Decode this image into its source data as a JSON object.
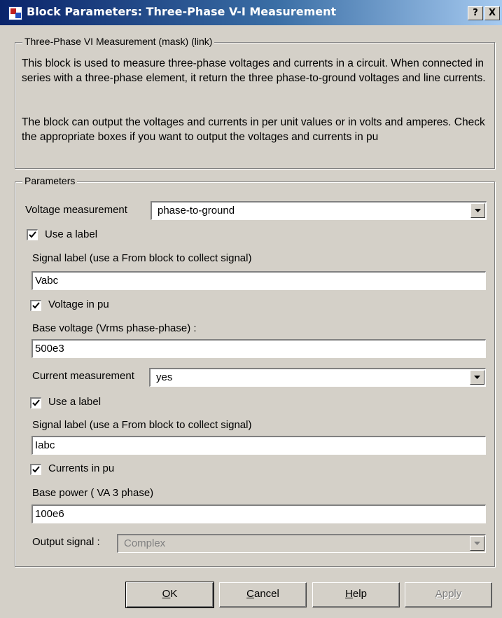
{
  "window": {
    "title": "Block Parameters: Three-Phase V-I Measurement",
    "help_label": "?",
    "close_label": "X"
  },
  "description": {
    "group_title": "Three-Phase VI Measurement (mask) (link)",
    "paragraph1": "This block is used to measure three-phase voltages and currents in a circuit. When connected in series with a  three-phase element, it return the three phase-to-ground voltages and line currents.",
    "paragraph2": "The block can output the voltages and currents in per unit values or in volts and amperes. Check the appropriate boxes if you want to output the voltages and currents in pu"
  },
  "parameters": {
    "group_title": "Parameters",
    "voltage_measurement": {
      "label": "Voltage measurement",
      "value": "phase-to-ground"
    },
    "voltage_use_label": {
      "label": "Use a label",
      "checked": true
    },
    "voltage_signal_label": {
      "label": "Signal label  (use a From block to collect signal)",
      "value": "Vabc"
    },
    "voltage_in_pu": {
      "label": "Voltage  in pu",
      "checked": true
    },
    "base_voltage": {
      "label": "Base voltage (Vrms phase-phase) :",
      "value": "500e3"
    },
    "current_measurement": {
      "label": "Current measurement",
      "value": "yes"
    },
    "current_use_label": {
      "label": "Use a label",
      "checked": true
    },
    "current_signal_label": {
      "label": "Signal label  (use a From block to collect signal)",
      "value": "Iabc"
    },
    "currents_in_pu": {
      "label": "Currents in pu",
      "checked": true
    },
    "base_power": {
      "label": "Base power ( VA 3 phase)",
      "value": "100e6"
    },
    "output_signal": {
      "label": "Output signal :",
      "value": "Complex",
      "enabled": false
    }
  },
  "buttons": {
    "ok": {
      "mnemonic": "O",
      "rest": "K"
    },
    "cancel": {
      "mnemonic": "C",
      "rest": "ancel"
    },
    "help": {
      "mnemonic": "H",
      "rest": "elp"
    },
    "apply": {
      "mnemonic": "A",
      "rest": "pply",
      "enabled": false
    }
  },
  "colors": {
    "title_bar_start": "#0a246a",
    "title_bar_end": "#a6caf0",
    "dialog_face": "#d4d0c8"
  }
}
